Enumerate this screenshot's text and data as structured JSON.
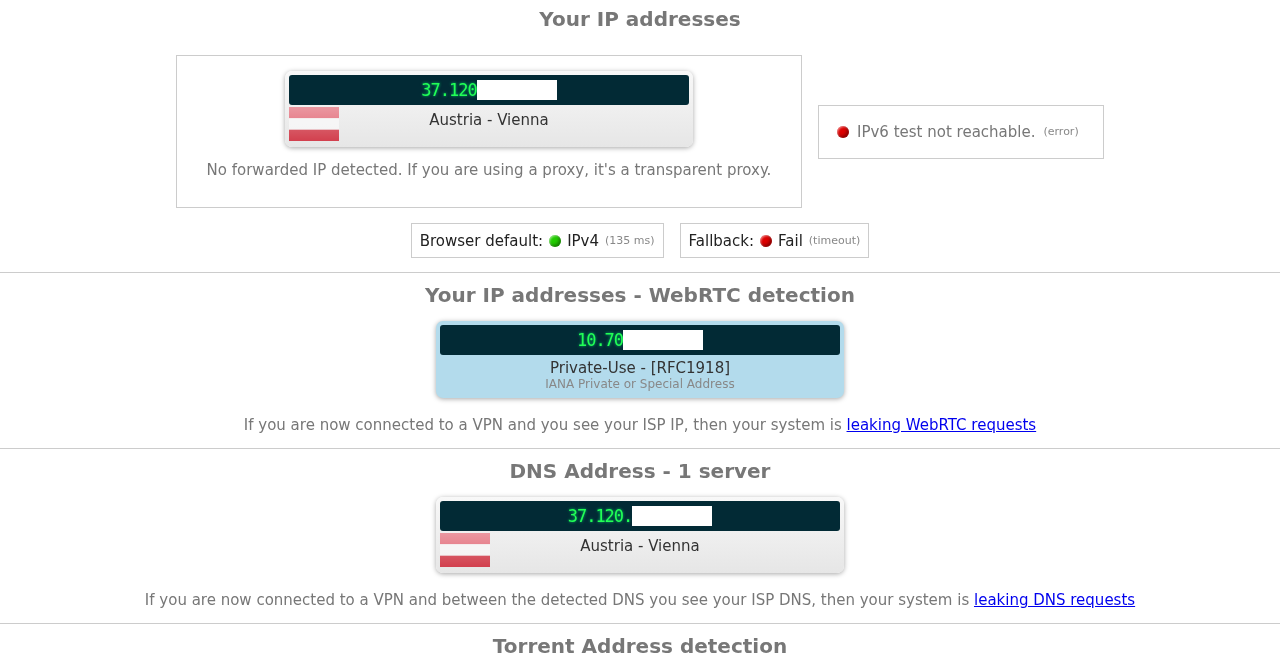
{
  "ip_section": {
    "title": "Your IP addresses",
    "address_card": {
      "kind": "geo",
      "ip": "37.120",
      "redacted": true,
      "location": "Austria - Vienna"
    },
    "note": "No forwarded IP detected. If you are using a proxy, it's a transparent proxy.",
    "ipv6_status": {
      "color": "#dd0000",
      "text": "IPv6 test not reachable.",
      "detail": "(error)"
    },
    "checks": [
      {
        "label": "Browser default:",
        "color": "#22cc00",
        "value": "IPv4",
        "detail": "(135 ms)"
      },
      {
        "label": "Fallback:",
        "color": "#dd0000",
        "value": "Fail",
        "detail": "(timeout)"
      }
    ]
  },
  "webrtc_section": {
    "title": "Your IP addresses - WebRTC detection",
    "address_card": {
      "kind": "private",
      "ip": "10.70",
      "redacted": true,
      "location": "Private-Use - [RFC1918]",
      "sublabel": "IANA Private or Special Address"
    },
    "note": {
      "text": "If you are now connected to a VPN and you see your ISP IP, then your system is",
      "link": "leaking WebRTC requests"
    }
  },
  "dns_section": {
    "title": "DNS Address - 1 server",
    "address_card": {
      "kind": "geo",
      "ip": "37.120.",
      "redacted": true,
      "location": "Austria - Vienna"
    },
    "note": {
      "text": "If you are now connected to a VPN and between the detected DNS you see your ISP DNS, then your system is",
      "link": "leaking DNS requests"
    }
  },
  "torrent_section": {
    "title": "Torrent Address detection"
  }
}
